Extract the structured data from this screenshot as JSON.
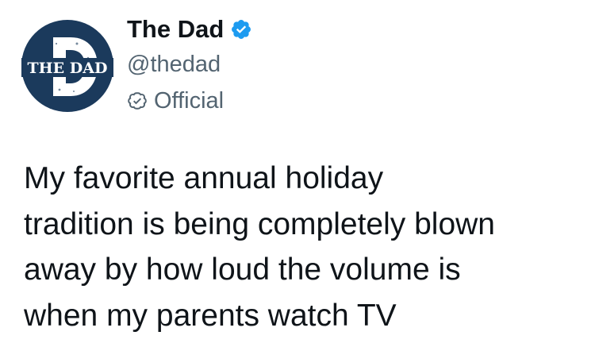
{
  "author": {
    "display_name": "The Dad",
    "handle": "@thedad",
    "label": "Official",
    "avatar_text": "THE DAD",
    "verified_icon": "verified-badge-icon",
    "official_icon": "official-check-icon",
    "brand_color": "#1b3a5c",
    "verified_color": "#1d9bf0"
  },
  "tweet": {
    "text": "My favorite annual holiday\ntradition is being completely blown\naway by how loud the volume is\nwhen my parents watch TV"
  }
}
